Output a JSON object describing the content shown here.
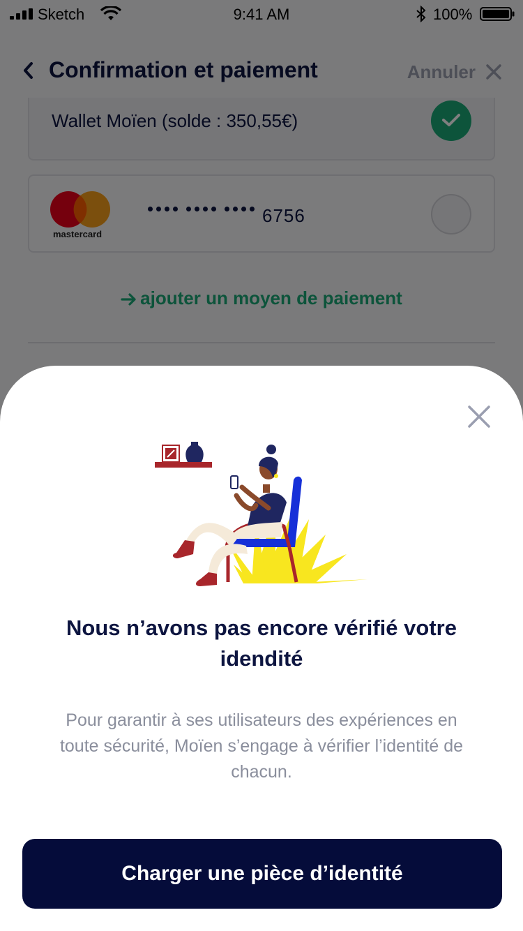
{
  "status_bar": {
    "carrier": "Sketch",
    "time": "9:41 AM",
    "battery": "100%"
  },
  "header": {
    "title": "Confirmation et paiement",
    "cancel_label": "Annuler"
  },
  "payment_methods": {
    "wallet_label": "Wallet Moïen (solde : 350,55€)",
    "card_brand": "mastercard",
    "card_last4": "6756",
    "add_payment_label": "ajouter un moyen de paiement"
  },
  "sheet": {
    "title": "Nous n’avons pas encore vérifié votre idendité",
    "body": "Pour garantir à ses utilisateurs des expériences en toute sécurité, Moïen s’engage à vérifier l’identité de chacun.",
    "cta_label": "Charger une pièce d’identité"
  },
  "colors": {
    "primary_navy": "#050c3a",
    "accent_green": "#1aa876",
    "muted_text": "#8a8e9c"
  },
  "icons": [
    "signal-icon",
    "wifi-icon",
    "bluetooth-icon",
    "battery-icon",
    "back-chevron-icon",
    "close-icon",
    "check-icon",
    "mastercard-logo",
    "arrow-right-icon"
  ]
}
